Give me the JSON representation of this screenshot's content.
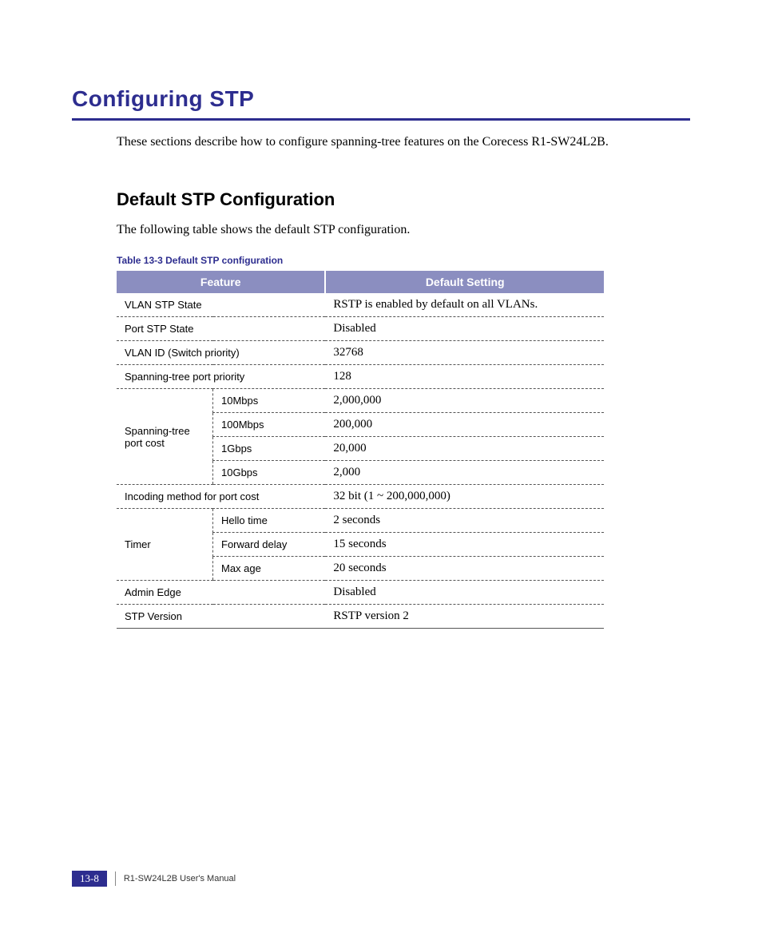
{
  "title": "Configuring STP",
  "intro": "These sections describe how to configure spanning-tree features on the Corecess R1-SW24L2B.",
  "section": {
    "heading": "Default STP Configuration",
    "intro": "The following table shows the default STP configuration.",
    "table_caption": "Table 13-3    Default STP configuration",
    "headers": {
      "feature": "Feature",
      "setting": "Default Setting"
    },
    "rows": {
      "vlan_stp_state": {
        "feature": "VLAN STP State",
        "setting": "RSTP is enabled by default on all VLANs."
      },
      "port_stp_state": {
        "feature": "Port STP State",
        "setting": "Disabled"
      },
      "vlan_id": {
        "feature": "VLAN ID (Switch priority)",
        "setting": "32768"
      },
      "port_priority": {
        "feature": "Spanning-tree port priority",
        "setting": "128"
      },
      "port_cost": {
        "feature": "Spanning-tree port cost",
        "subrows": [
          {
            "label": "10Mbps",
            "setting": "2,000,000"
          },
          {
            "label": "100Mbps",
            "setting": "200,000"
          },
          {
            "label": "1Gbps",
            "setting": "20,000"
          },
          {
            "label": "10Gbps",
            "setting": "2,000"
          }
        ]
      },
      "incoding": {
        "feature": "Incoding method for port cost",
        "setting": "32 bit (1 ~ 200,000,000)"
      },
      "timer": {
        "feature": "Timer",
        "subrows": [
          {
            "label": "Hello time",
            "setting": "2 seconds"
          },
          {
            "label": "Forward delay",
            "setting": "15 seconds"
          },
          {
            "label": "Max age",
            "setting": "20 seconds"
          }
        ]
      },
      "admin_edge": {
        "feature": "Admin Edge",
        "setting": "Disabled"
      },
      "stp_version": {
        "feature": "STP Version",
        "setting": "RSTP version 2"
      }
    }
  },
  "footer": {
    "page_number": "13-8",
    "manual": "R1-SW24L2B    User's Manual"
  }
}
